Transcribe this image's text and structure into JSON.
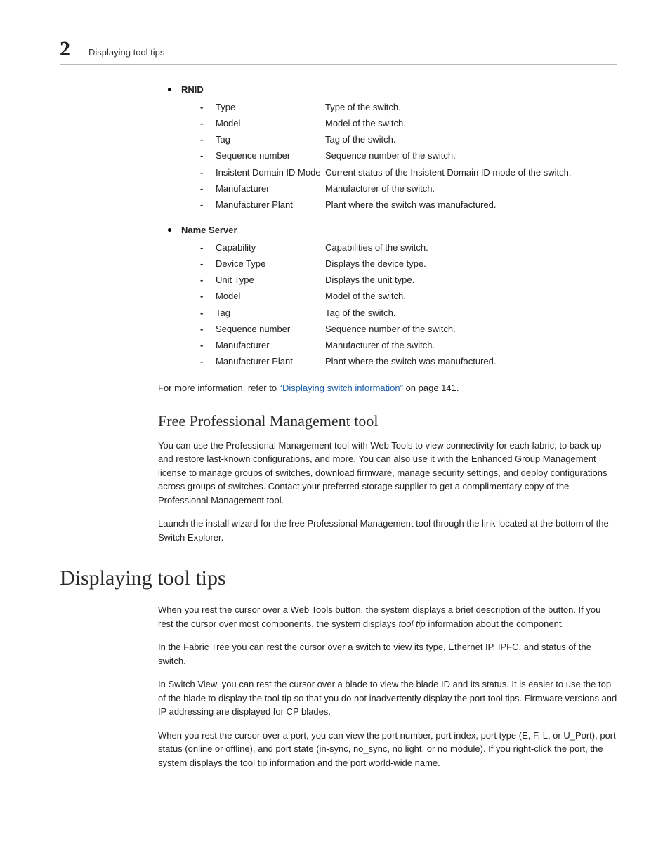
{
  "header": {
    "chapter_number": "2",
    "running_title": "Displaying tool tips"
  },
  "sections": {
    "rnid": {
      "title": "RNID",
      "rows": [
        {
          "term": "Type",
          "desc": "Type of the switch."
        },
        {
          "term": "Model",
          "desc": "Model of the switch."
        },
        {
          "term": "Tag",
          "desc": "Tag of the switch."
        },
        {
          "term": "Sequence number",
          "desc": "Sequence number of the switch."
        },
        {
          "term": "Insistent Domain ID Mode",
          "desc": "Current status of the Insistent Domain ID mode of the switch."
        },
        {
          "term": "Manufacturer",
          "desc": "Manufacturer of the switch."
        },
        {
          "term": "Manufacturer Plant",
          "desc": "Plant where the switch was manufactured."
        }
      ]
    },
    "name_server": {
      "title": "Name Server",
      "rows": [
        {
          "term": "Capability",
          "desc": "Capabilities of the switch."
        },
        {
          "term": "Device Type",
          "desc": "Displays the device type."
        },
        {
          "term": "Unit Type",
          "desc": "Displays the unit type."
        },
        {
          "term": "Model",
          "desc": "Model of the switch."
        },
        {
          "term": "Tag",
          "desc": "Tag of the switch."
        },
        {
          "term": "Sequence number",
          "desc": "Sequence number of the switch."
        },
        {
          "term": "Manufacturer",
          "desc": "Manufacturer of the switch."
        },
        {
          "term": "Manufacturer Plant",
          "desc": "Plant where the switch was manufactured."
        }
      ]
    },
    "more_info": {
      "pre": "For more information, refer to ",
      "link": "“Displaying switch information”",
      "post": " on page 141."
    },
    "free_pm": {
      "heading": "Free Professional Management tool",
      "p1": "You can use the Professional Management tool with Web Tools to view connectivity for each fabric, to back up and restore last-known configurations, and more. You can also use it with the Enhanced Group Management license to manage groups of switches, download firmware, manage security settings, and deploy configurations across groups of switches. Contact your preferred storage supplier to get a complimentary copy of the Professional Management tool.",
      "p2": "Launch the install wizard for the free Professional Management tool through the link located at the bottom of the Switch Explorer."
    },
    "tool_tips": {
      "heading": "Displaying tool tips",
      "p1_pre": "When you rest the cursor over a Web Tools button, the system displays a brief description of the button. If you rest the cursor over most components, the system displays ",
      "p1_em": "tool tip",
      "p1_post": " information about the component.",
      "p2": "In the Fabric Tree you can rest the cursor over a switch to view its type, Ethernet IP, IPFC, and status of the switch.",
      "p3": "In Switch View, you can rest the cursor over a blade to view the blade ID and its status. It is easier to use the top of the blade to display the tool tip so that you do not inadvertently display the port tool tips. Firmware versions and IP addressing are displayed for CP blades.",
      "p4": "When you rest the cursor over a port, you can view the port number, port index, port type (E, F, L, or U_Port), port status (online or offline), and port state (in-sync, no_sync, no light, or no module). If you right-click the port, the system displays the tool tip information and the port world-wide name."
    }
  }
}
